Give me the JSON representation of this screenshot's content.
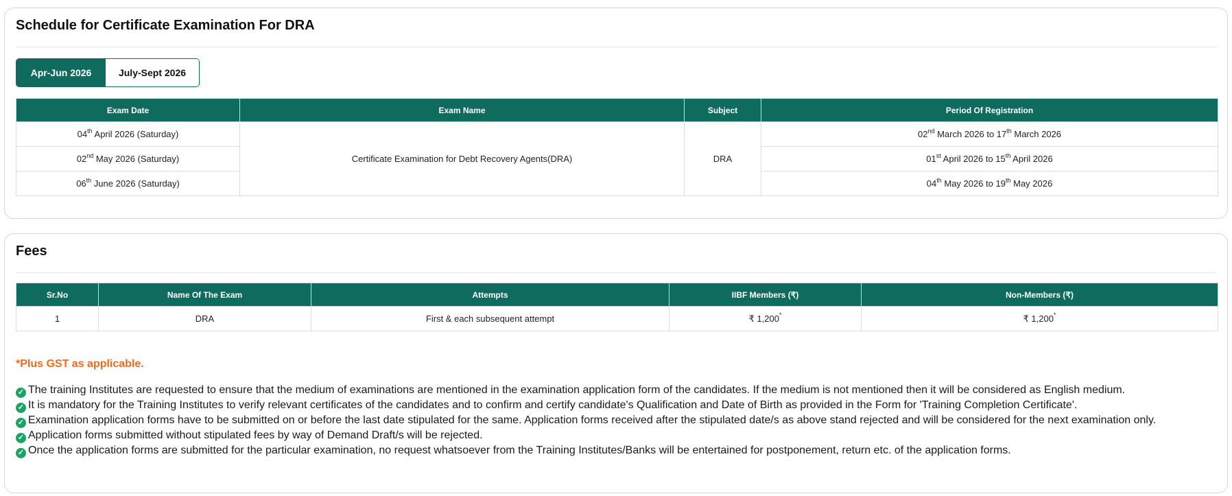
{
  "schedule": {
    "title": "Schedule for Certificate Examination For DRA",
    "tabs": [
      {
        "label": "Apr-Jun 2026",
        "active": true
      },
      {
        "label": "July-Sept 2026",
        "active": false
      }
    ],
    "headers": [
      "Exam Date",
      "Exam Name",
      "Subject",
      "Period Of Registration"
    ],
    "exam_name": "Certificate Examination for Debt Recovery Agents(DRA)",
    "subject": "DRA",
    "rows": [
      {
        "date_day": "04",
        "date_sup": "th",
        "date_rest": " April 2026 (Saturday)",
        "reg_start_day": "02",
        "reg_start_sup": "nd",
        "reg_start_rest": " March 2026 to 17",
        "reg_end_sup": "th",
        "reg_end_rest": " March 2026"
      },
      {
        "date_day": "02",
        "date_sup": "nd",
        "date_rest": " May 2026 (Saturday)",
        "reg_start_day": "01",
        "reg_start_sup": "st",
        "reg_start_rest": " April 2026 to 15",
        "reg_end_sup": "th",
        "reg_end_rest": " April 2026"
      },
      {
        "date_day": "06",
        "date_sup": "th",
        "date_rest": " June 2026 (Saturday)",
        "reg_start_day": "04",
        "reg_start_sup": "th",
        "reg_start_rest": " May 2026 to 19",
        "reg_end_sup": "th",
        "reg_end_rest": " May 2026"
      }
    ]
  },
  "fees": {
    "title": "Fees",
    "headers": [
      "Sr.No",
      "Name Of The Exam",
      "Attempts",
      "IIBF Members (₹)",
      "Non-Members (₹)"
    ],
    "rows": [
      {
        "sr": "1",
        "name": "DRA",
        "attempts": "First & each subsequent attempt",
        "members": "₹ 1,200",
        "non_members": "₹ 1,200",
        "star": "*"
      }
    ],
    "gst_note": "*Plus GST as applicable.",
    "notes": [
      "The training Institutes are requested to ensure that the medium of examinations are mentioned in the examination application form of the candidates. If the medium is not mentioned then it will be considered as English medium.",
      "It is mandatory for the Training Institutes to verify relevant certificates of the candidates and to confirm and certify candidate's Qualification and Date of Birth as provided in the Form for 'Training Completion Certificate'.",
      "Examination application forms have to be submitted on or before the last date stipulated for the same. Application forms received after the stipulated date/s as above stand rejected and will be considered for the next examination only.",
      "Application forms submitted without stipulated fees by way of Demand Draft/s will be rejected.",
      "Once the application forms are submitted for the particular examination, no request whatsoever from the Training Institutes/Banks will be entertained for postponement, return etc. of the application forms."
    ],
    "check_icon": "✓"
  },
  "colors": {
    "primary": "#0e6b5e",
    "accent": "#ef6a1d",
    "check": "#19a463"
  }
}
